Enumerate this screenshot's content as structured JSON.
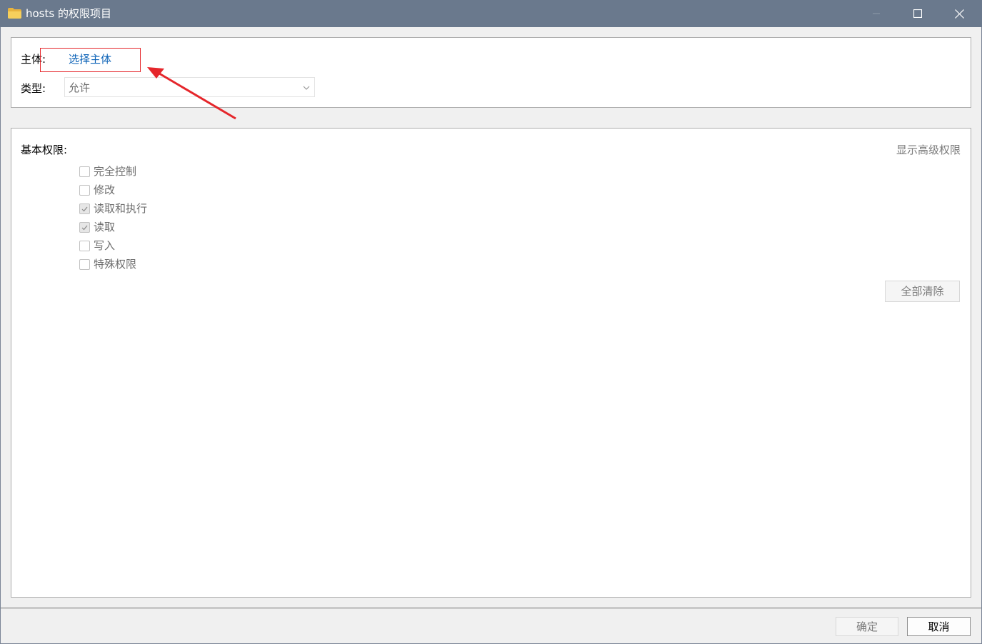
{
  "window": {
    "title": "hosts 的权限项目",
    "icon": "folder-icon",
    "controls": {
      "minimize_icon": "minimize-icon",
      "maximize_icon": "maximize-icon",
      "close_icon": "close-icon"
    }
  },
  "principal": {
    "label": "主体:",
    "link": "选择主体"
  },
  "type": {
    "label": "类型:",
    "selected": "允许"
  },
  "permissions": {
    "heading": "基本权限:",
    "advanced_link": "显示高级权限",
    "items": [
      {
        "label": "完全控制",
        "checked": false
      },
      {
        "label": "修改",
        "checked": false
      },
      {
        "label": "读取和执行",
        "checked": true
      },
      {
        "label": "读取",
        "checked": true
      },
      {
        "label": "写入",
        "checked": false
      },
      {
        "label": "特殊权限",
        "checked": false
      }
    ],
    "clear_all": "全部清除"
  },
  "footer": {
    "ok": "确定",
    "cancel": "取消"
  },
  "colors": {
    "titlebar": "#6a798d",
    "link": "#0b62b7",
    "annotation": "#e5262b"
  }
}
